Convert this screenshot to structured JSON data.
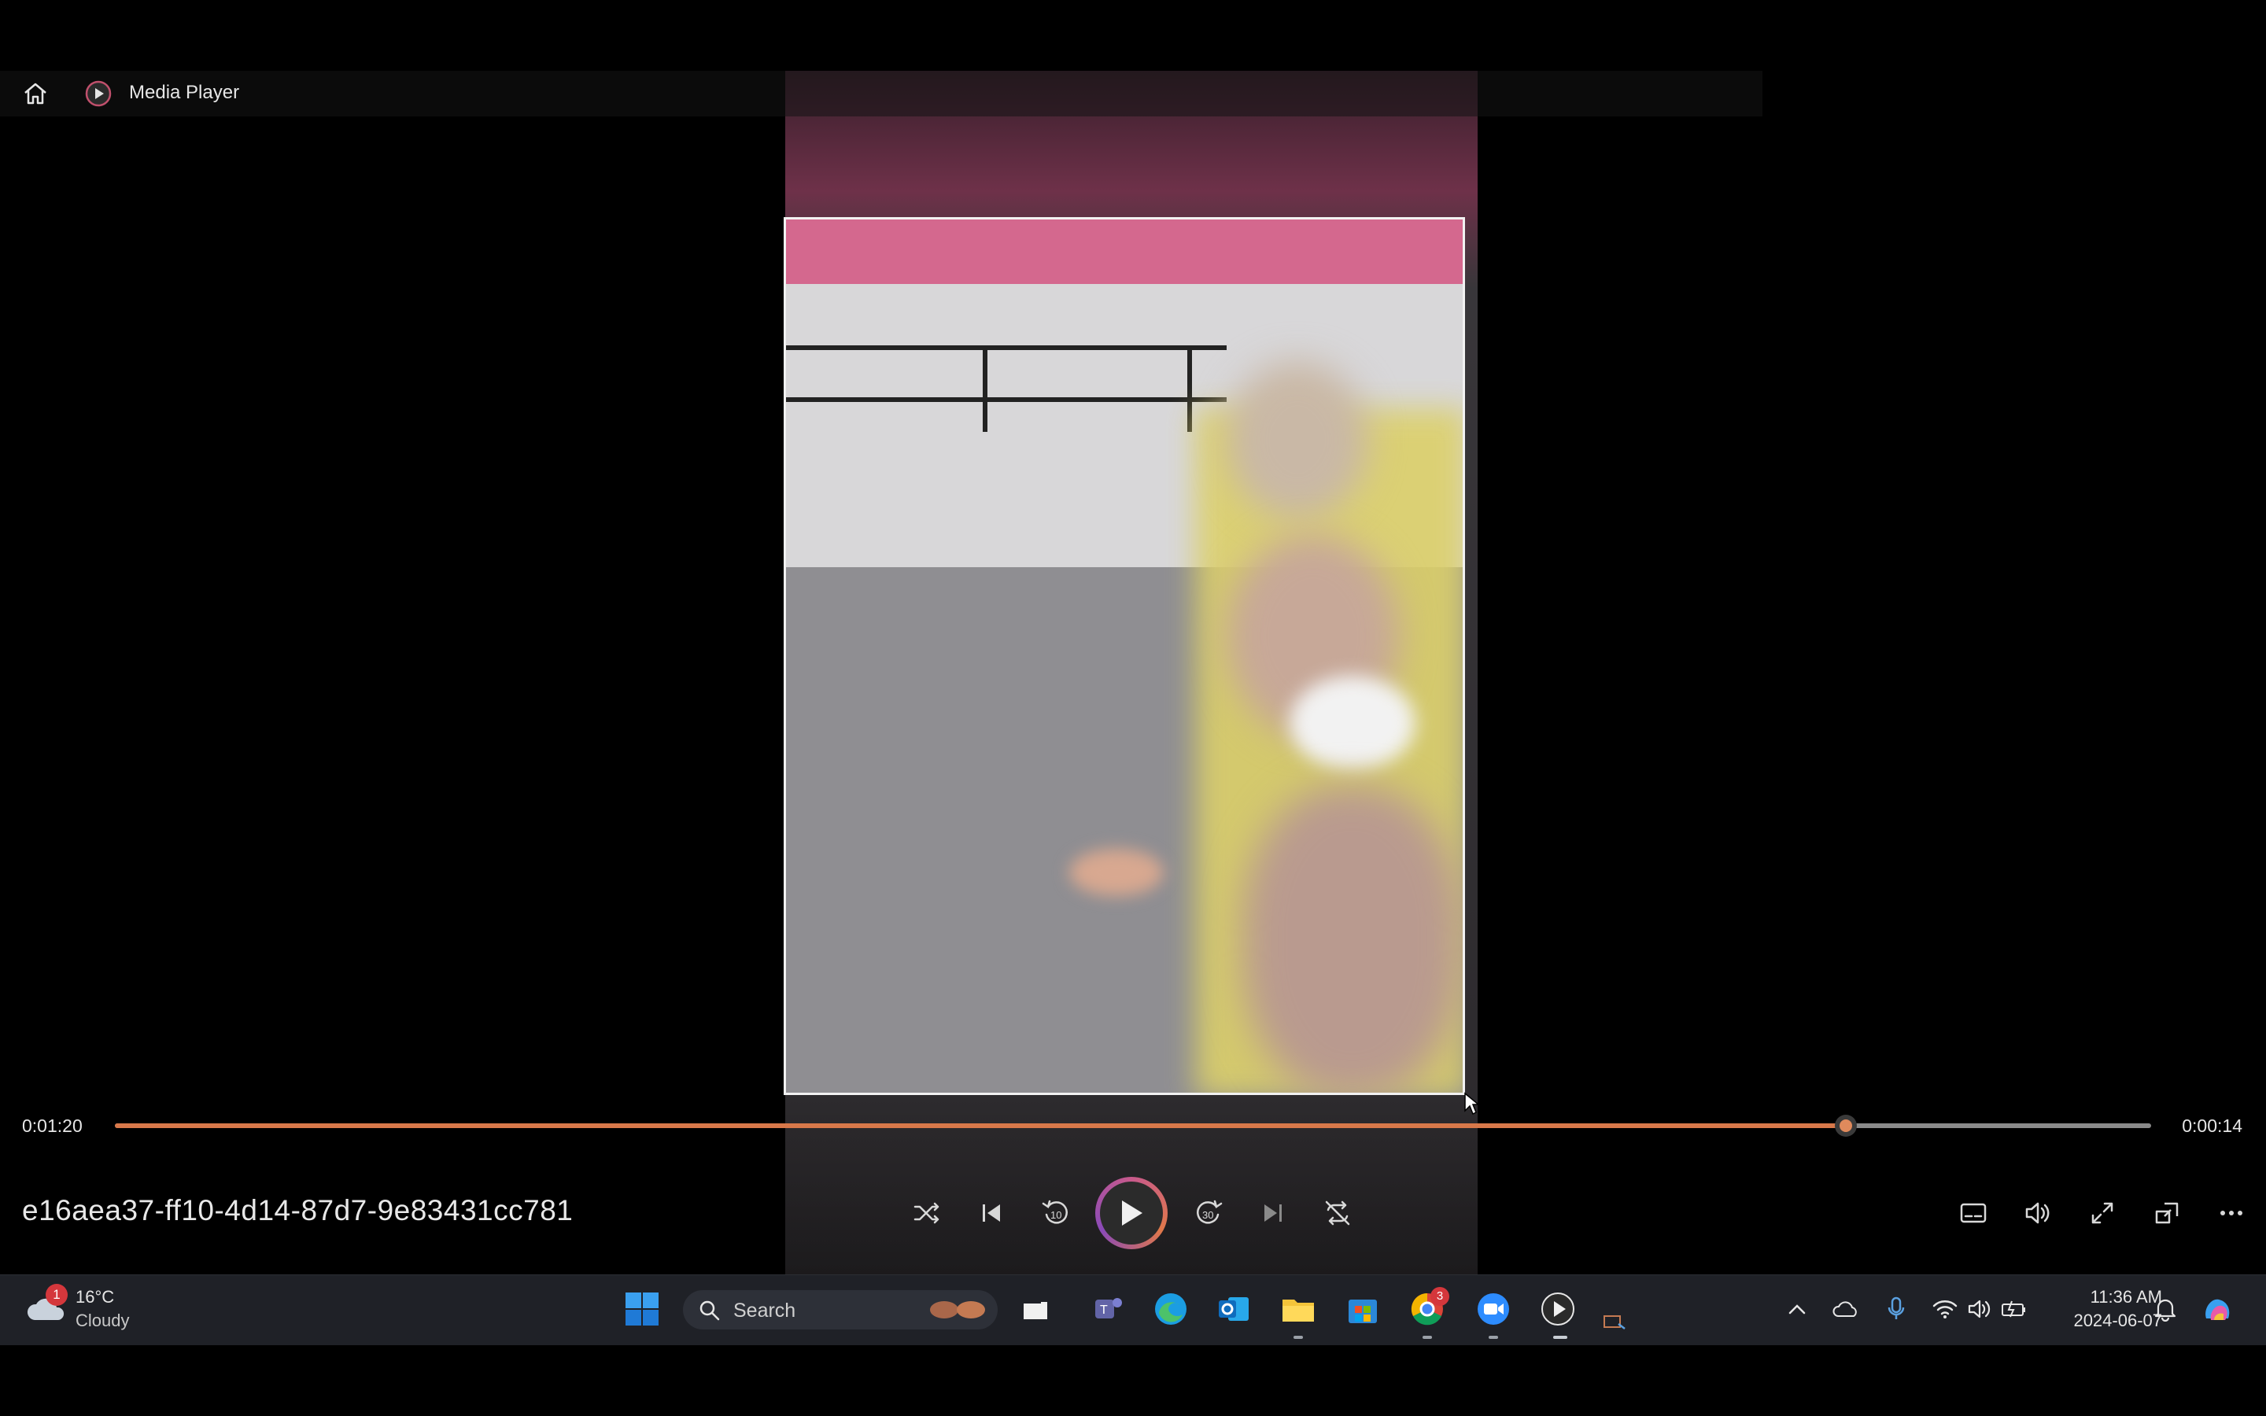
{
  "window": {
    "app_title": "Media Player",
    "icons": {
      "home": "home-icon",
      "app": "media-player-icon"
    }
  },
  "player": {
    "filename": "e16aea37-ff10-4d14-87d7-9e83431cc781",
    "elapsed": "0:01:20",
    "remaining": "0:00:14",
    "progress_percent": 85,
    "controls": [
      {
        "name": "shuffle",
        "icon": "shuffle-icon"
      },
      {
        "name": "previous",
        "icon": "previous-track-icon"
      },
      {
        "name": "skip-back-10",
        "icon": "replay-10-icon",
        "label": "10"
      },
      {
        "name": "play",
        "icon": "play-icon"
      },
      {
        "name": "skip-forward-30",
        "icon": "forward-30-icon",
        "label": "30"
      },
      {
        "name": "next",
        "icon": "next-track-icon"
      },
      {
        "name": "repeat",
        "icon": "repeat-off-icon"
      }
    ],
    "right_controls": [
      {
        "name": "captions",
        "icon": "captions-icon"
      },
      {
        "name": "volume",
        "icon": "volume-icon"
      },
      {
        "name": "fullscreen",
        "icon": "fullscreen-icon"
      },
      {
        "name": "mini-player",
        "icon": "mini-player-icon"
      },
      {
        "name": "more",
        "icon": "more-options-icon"
      }
    ]
  },
  "taskbar": {
    "weather": {
      "temp": "16°C",
      "desc": "Cloudy",
      "badge": "1"
    },
    "search_label": "Search",
    "chrome_badge": "3",
    "clock": {
      "time": "11:36 AM",
      "date": "2024-06-07"
    },
    "apps": [
      "windows-start-icon",
      "search-icon",
      "file-explorer-icon",
      "teams-icon",
      "edge-icon",
      "outlook-icon",
      "folder-icon",
      "store-icon",
      "chrome-icon",
      "zoom-icon",
      "media-player-icon"
    ],
    "tray": [
      "chevron-up-icon",
      "onedrive-icon",
      "microphone-icon",
      "wifi-icon",
      "speaker-icon",
      "battery-icon",
      "notification-bell-icon",
      "copilot-icon"
    ]
  },
  "colors": {
    "accent": "#d8784a",
    "taskbar_bg": "#1f2127",
    "badge_red": "#d4373c"
  }
}
